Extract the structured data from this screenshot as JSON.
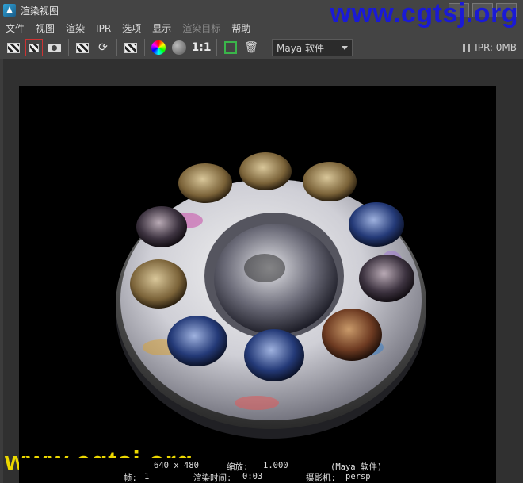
{
  "window": {
    "title": "渲染视图"
  },
  "watermarks": {
    "top": "www.cgtsj.org",
    "bottom": "www.cgtsj.org"
  },
  "menubar": {
    "items": [
      "文件",
      "视图",
      "渲染",
      "IPR",
      "选项",
      "显示",
      "渲染目标",
      "帮助"
    ]
  },
  "toolbar": {
    "ratio_label": "1:1",
    "renderer": "Maya 软件",
    "ipr_status": "IPR: 0MB",
    "icons": [
      "render-frame-icon",
      "render-region-icon",
      "snapshot-icon",
      "ipr-render-icon",
      "refresh-ipr-icon",
      "render-sequence-icon",
      "rgb-channels-icon",
      "alpha-channel-icon",
      "real-size-icon",
      "keep-image-icon",
      "remove-image-icon"
    ]
  },
  "status": {
    "resolution": "640 x 480",
    "zoom_label": "缩放:",
    "zoom_value": "1.000",
    "renderer_tag": "(Maya 软件)",
    "frame_label": "帧:",
    "frame_value": "1",
    "render_time_label": "渲染时间:",
    "render_time_value": "0:03",
    "camera_label": "摄影机:",
    "camera_value": "persp"
  },
  "colors": {
    "background": "#3c3c3c",
    "render_bg": "#000000",
    "watermark_top": "#1a1ad6",
    "watermark_bottom": "#ecd800"
  }
}
